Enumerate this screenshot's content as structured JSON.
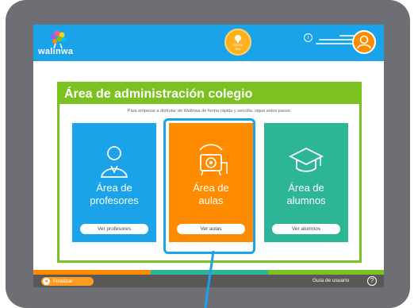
{
  "topbar": {
    "logo_text": "walinwa",
    "level_badge": [
      "PRIMA",
      "RIA"
    ],
    "info_icon": "info-icon",
    "avatar_icon": "user-avatar-icon"
  },
  "panel": {
    "title": "Área de administración colegio",
    "subtitle": "Para empezar a disfrutar de Walinwa de forma rápida y sencilla, sigue estos pasos:"
  },
  "cards": {
    "profesores": {
      "line1": "Área de",
      "line2": "profesores",
      "button": "Ver profesores",
      "icon": "teacher-icon",
      "color": "#1aa3e8"
    },
    "aulas": {
      "line1": "Área de",
      "line2": "aulas",
      "button": "Ver aulas",
      "icon": "school-bell-icon",
      "color": "#ff8c00"
    },
    "alumnos": {
      "line1": "Área de",
      "line2": "alumnos",
      "button": "Ver alumnos",
      "icon": "graduation-cap-icon",
      "color": "#2db598"
    }
  },
  "footer": {
    "finalizar": "Finalizar",
    "guide": "Guía de usuario",
    "help": "?"
  },
  "colors": {
    "primary_blue": "#1aa3e8",
    "accent_green": "#7bc11f",
    "orange": "#ff8c00",
    "teal": "#2db598",
    "footer_gray": "#585858",
    "frame_gray": "#6e6f74"
  }
}
